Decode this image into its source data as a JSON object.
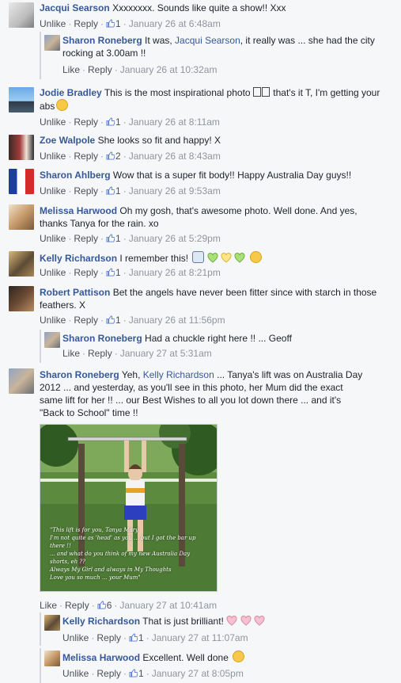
{
  "comments": [
    {
      "author": "Jacqui Searson",
      "text": "Xxxxxxxx. Sounds like quite a show!! Xxx",
      "like": "Unlike",
      "reply": "Reply",
      "count": "1",
      "time": "January 26 at 6:48am"
    },
    {
      "author": "Sharon Roneberg",
      "text_pre": "It was, ",
      "mention": "Jacqui Searson",
      "text_post": ", it really was ... she had the city rocking at 3.00am !!",
      "like": "Like",
      "reply": "Reply",
      "time": "January 26 at 10:32am"
    },
    {
      "author": "Jodie Bradley",
      "text_pre": "This is the most inspirational photo ",
      "text_post": " that's it T, I'm getting your abs",
      "like": "Unlike",
      "reply": "Reply",
      "count": "1",
      "time": "January 26 at 8:11am"
    },
    {
      "author": "Zoe Walpole",
      "text": "She looks so fit and happy! X",
      "like": "Unlike",
      "reply": "Reply",
      "count": "2",
      "time": "January 26 at 8:43am"
    },
    {
      "author": "Sharon Ahlberg",
      "text": "Wow that is a super fit body!! Happy Australia Day guys!!",
      "like": "Unlike",
      "reply": "Reply",
      "count": "1",
      "time": "January 26 at 9:53am"
    },
    {
      "author": "Melissa Harwood",
      "text": "Oh my gosh, that's awesome photo. Well done. And yes, thanks Tanya for the rain. xo",
      "like": "Unlike",
      "reply": "Reply",
      "count": "1",
      "time": "January 26 at 5:29pm"
    },
    {
      "author": "Kelly Richardson",
      "text": "I remember this!",
      "like": "Unlike",
      "reply": "Reply",
      "count": "1",
      "time": "January 26 at 8:21pm"
    },
    {
      "author": "Robert Pattison",
      "text": "Bet the angels have never been fitter since with starch in those feathers. X",
      "like": "Unlike",
      "reply": "Reply",
      "count": "1",
      "time": "January 26 at 11:56pm"
    },
    {
      "author": "Sharon Roneberg",
      "text": "Had a chuckle right here !! ... Geoff",
      "like": "Like",
      "reply": "Reply",
      "time": "January 27 at 5:31am"
    },
    {
      "author": "Sharon Roneberg",
      "text_pre": "Yeh, ",
      "mention": "Kelly Richardson",
      "text_post": " ... Tanya's lift was on Australia Day 2012 ... and yesterday, as you'll see in this photo, her Mum did the exact same lift for her !! ... our Best Wishes to all you lot down there ... and it's \"Back to School\" time !!",
      "like": "Like",
      "reply": "Reply",
      "count": "6",
      "time": "January 27 at 10:41am"
    },
    {
      "author": "Kelly Richardson",
      "text": "That is just brilliant!",
      "like": "Unlike",
      "reply": "Reply",
      "count": "1",
      "time": "January 27 at 11:07am"
    },
    {
      "author": "Melissa Harwood",
      "text": "Excellent. Well done",
      "like": "Unlike",
      "reply": "Reply",
      "count": "1",
      "time": "January 27 at 8:05pm"
    }
  ],
  "photo_caption": "\"This lift is for you, Tanya Mary\nI'm not quite as 'head' as you ... but I got the bar up there !!\n... and what do you think of my new Australia Day shorts, eh ??\nAlways My Girl and always in My Thoughts\nLove you so much ... your Mum\"",
  "colors": {
    "link": "#365899",
    "meta": "#90949c",
    "bg": "#f6f7f9"
  }
}
